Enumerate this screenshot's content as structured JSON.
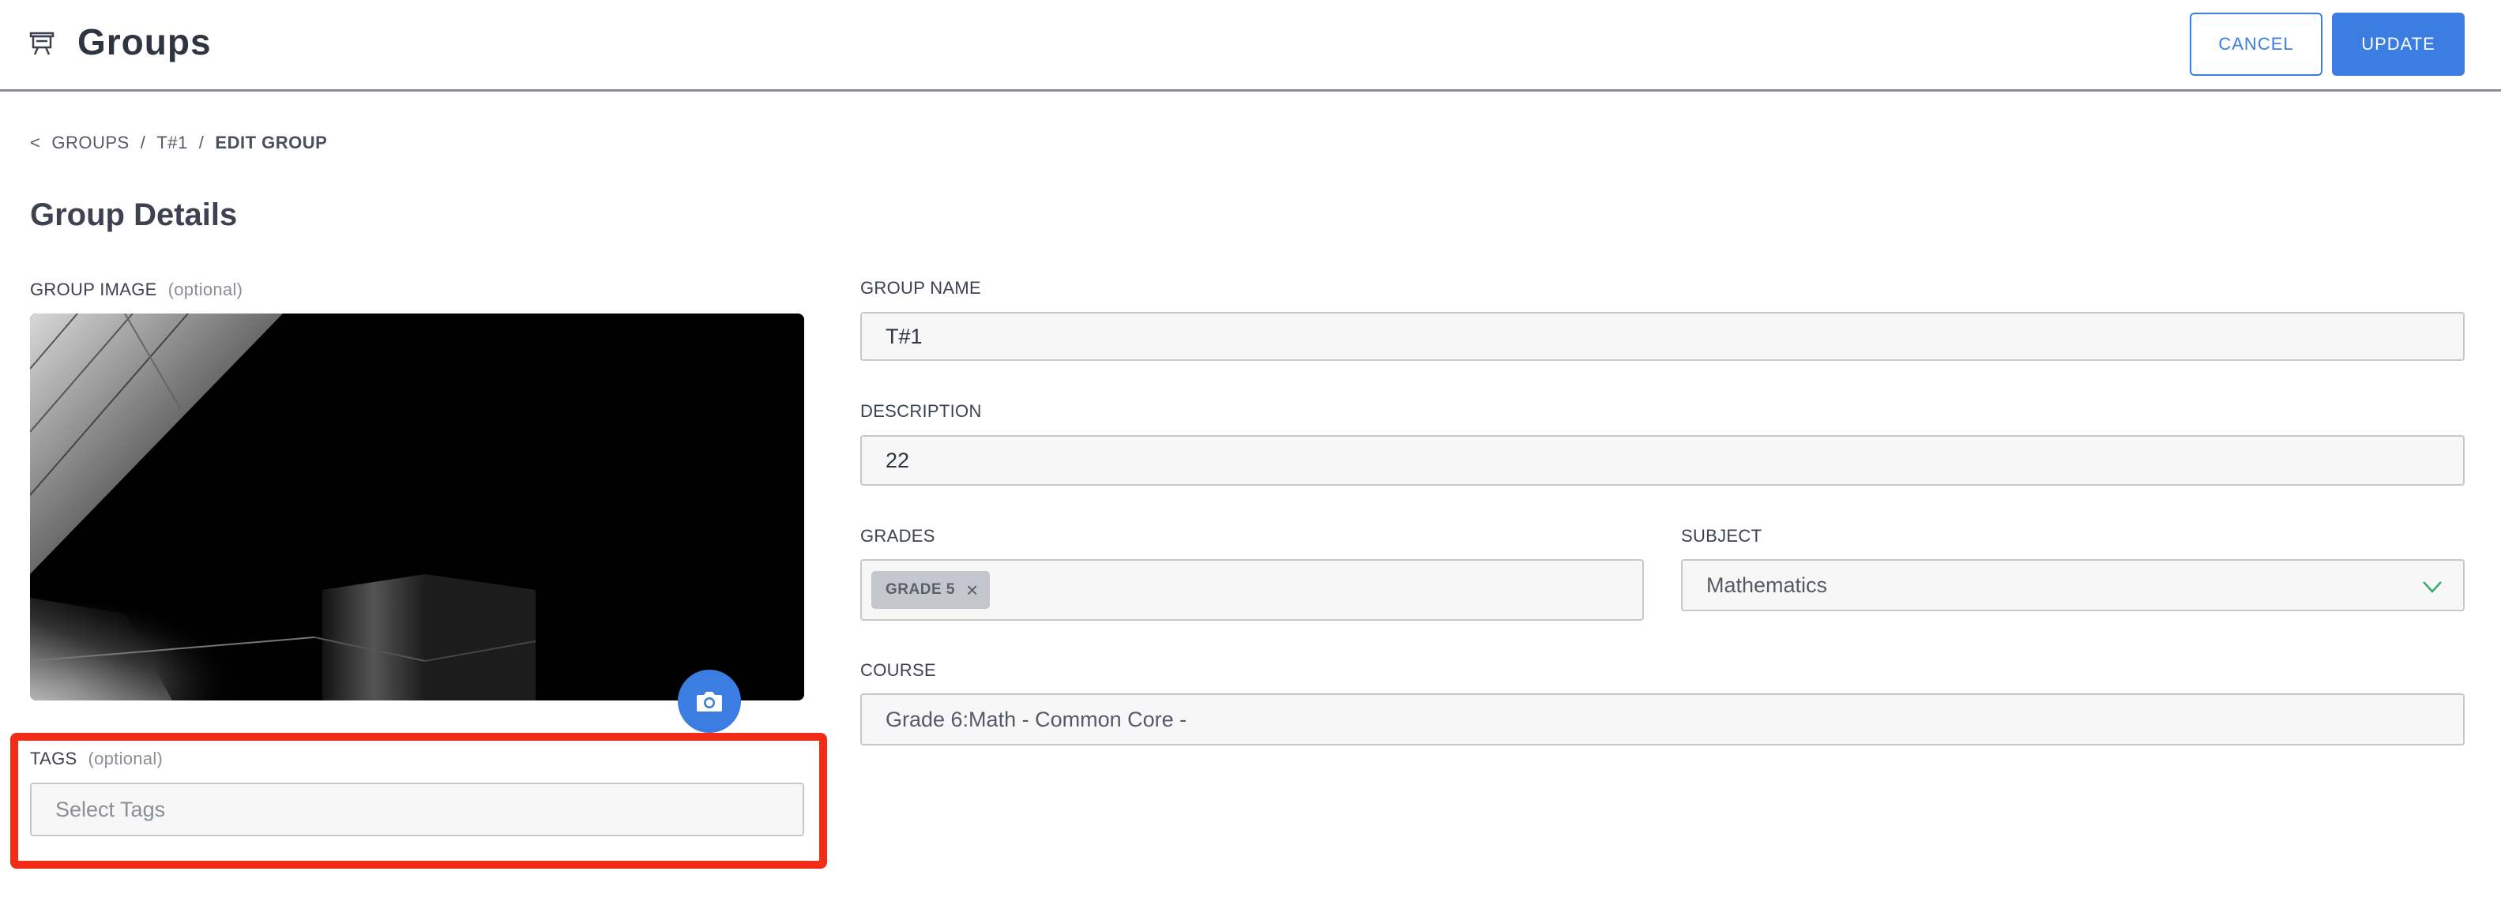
{
  "header": {
    "title": "Groups",
    "cancel_label": "CANCEL",
    "update_label": "UPDATE",
    "icon": "presentation-board-icon"
  },
  "breadcrumb": {
    "back": "<",
    "items": [
      "GROUPS",
      "T#1",
      "EDIT GROUP"
    ],
    "separator": "/"
  },
  "section_title": "Group Details",
  "form": {
    "group_image_label": "GROUP IMAGE",
    "group_image_optional": "(optional)",
    "tags_label": "TAGS",
    "tags_optional": "(optional)",
    "tags_placeholder": "Select Tags",
    "group_name_label": "GROUP NAME",
    "group_name_value": "T#1",
    "description_label": "DESCRIPTION",
    "description_value": "22",
    "grades_label": "GRADES",
    "grades_selected": [
      "GRADE 5"
    ],
    "subject_label": "SUBJECT",
    "subject_value": "Mathematics",
    "course_label": "COURSE",
    "course_value": "Grade 6:Math - Common Core -"
  },
  "colors": {
    "accent": "#3b7de0",
    "highlight": "#f22c16",
    "chevron": "#2fae6b"
  }
}
